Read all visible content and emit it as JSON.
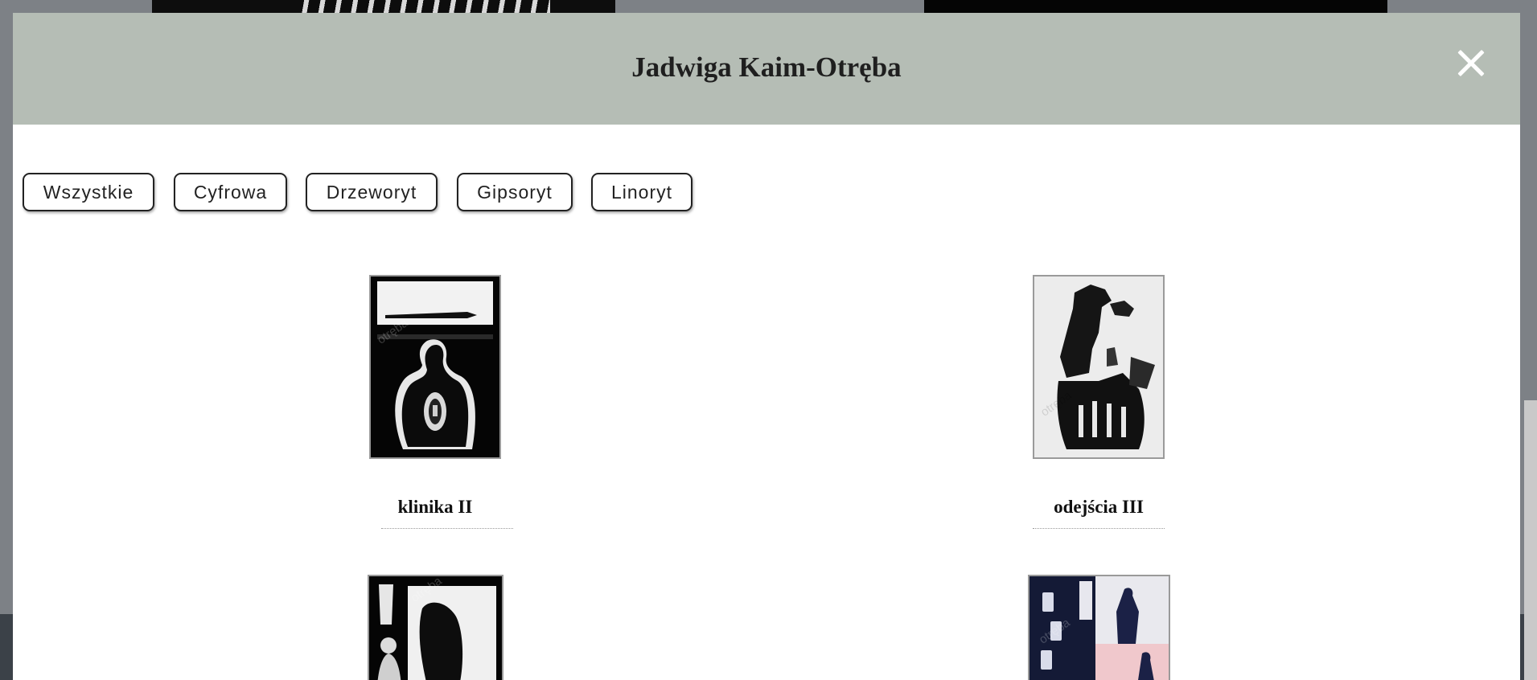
{
  "modal": {
    "title": "Jadwiga Kaim-Otręba"
  },
  "filters": [
    {
      "label": "Wszystkie"
    },
    {
      "label": "Cyfrowa"
    },
    {
      "label": "Drzeworyt"
    },
    {
      "label": "Gipsoryt"
    },
    {
      "label": "Linoryt"
    }
  ],
  "gallery": [
    {
      "title": "klinika II",
      "watermark": "otręba"
    },
    {
      "title": "odejścia III",
      "watermark": "otręba"
    },
    {
      "title": "",
      "watermark": "otręba"
    },
    {
      "title": "",
      "watermark": "otręba"
    }
  ],
  "icons": {
    "close": "close-icon"
  }
}
